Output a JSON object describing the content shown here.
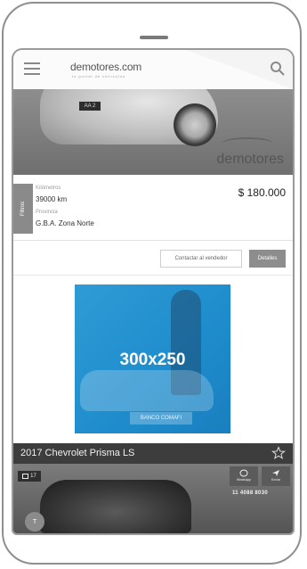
{
  "header": {
    "logo_text": "demotores.com",
    "tagline": "tu portal de vehículos"
  },
  "listing1": {
    "photo_brand": "demotores",
    "plate_text": "AA 2",
    "km_label": "Kilómetros",
    "km_value": "39000 km",
    "province_label": "Provincia",
    "province_value": "G.B.A. Zona Norte",
    "price": "$ 180.000",
    "contact_button": "Contactar al vendedor",
    "details_button": "Detalles"
  },
  "filter_tab": "Filtros",
  "ad": {
    "size_label": "300x250",
    "bank_label": "BANCO COMAFI"
  },
  "listing2": {
    "title": "2017 Chevrolet Prisma LS",
    "photo_count": "17",
    "whatsapp_label": "WhatsApp",
    "send_label": "Enviar",
    "phone_number": "11 4088 8030"
  },
  "fab_label": "T",
  "colors": {
    "ad_blue": "#2394d2",
    "dark_bar": "#3d3d3d",
    "button_gray": "#8d8d8d"
  }
}
